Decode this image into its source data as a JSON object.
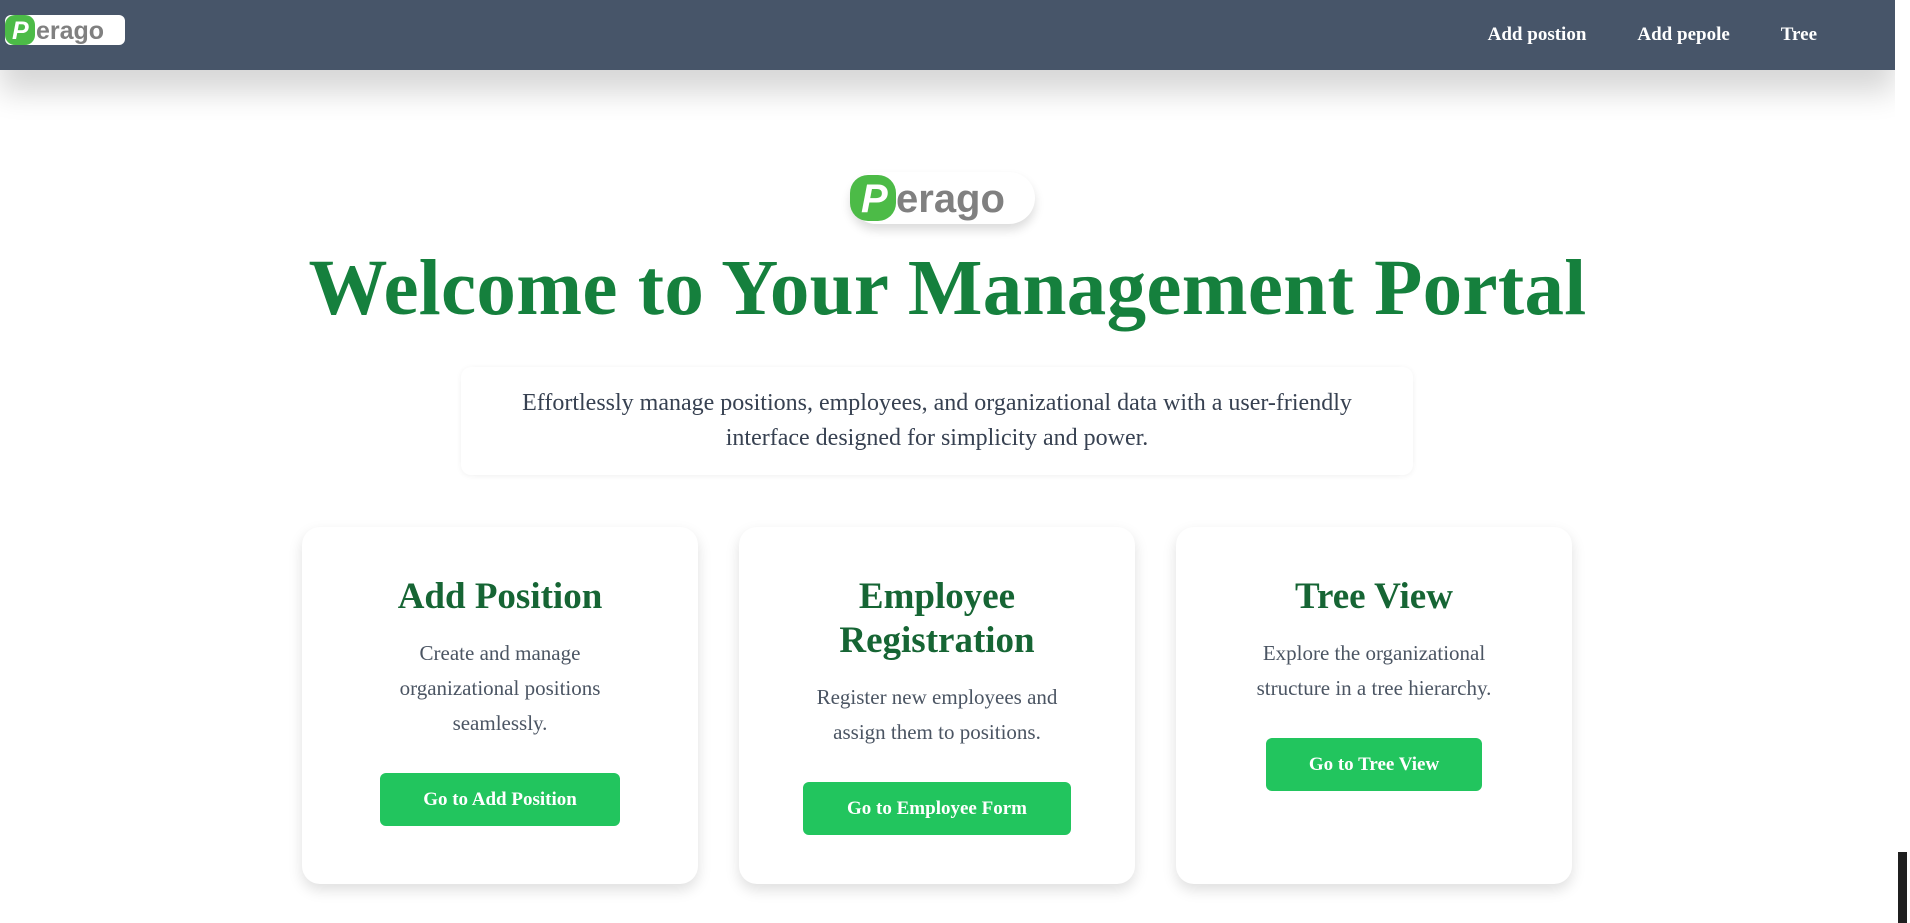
{
  "brand": {
    "logo_initial": "P",
    "logo_rest": "erago",
    "colors": {
      "logo_green": "#4cbb47",
      "logo_gray": "#808080",
      "navbar": "#475569",
      "title_green": "#15803d",
      "button_green": "#22c55e"
    }
  },
  "nav": {
    "links": [
      {
        "label": "Add postion"
      },
      {
        "label": "Add pepole"
      },
      {
        "label": "Tree"
      }
    ]
  },
  "hero": {
    "title": "Welcome to Your Management Portal",
    "subtitle": "Effortlessly manage positions, employees, and organizational data with a user-friendly interface designed for simplicity and power."
  },
  "cards": [
    {
      "title": "Add Position",
      "description": "Create and manage organizational positions seamlessly.",
      "button": "Go to Add Position"
    },
    {
      "title": "Employee Registration",
      "description": "Register new employees and assign them to positions.",
      "button": "Go to Employee Form"
    },
    {
      "title": "Tree View",
      "description": "Explore the organizational structure in a tree hierarchy.",
      "button": "Go to Tree View"
    }
  ]
}
